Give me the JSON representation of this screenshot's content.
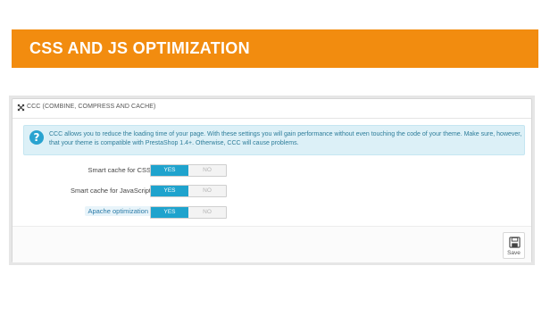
{
  "banner": {
    "title": "CSS AND JS OPTIMIZATION"
  },
  "panel": {
    "title": "CCC (COMBINE, COMPRESS AND CACHE)",
    "head_icon": "expand-arrows-icon",
    "info": {
      "icon": "question-icon",
      "icon_glyph": "?",
      "text": "CCC allows you to reduce the loading time of your page. With these settings you will gain performance without even touching the code of your theme. Make sure, however, that your theme is compatible with PrestaShop 1.4+. Otherwise, CCC will cause problems."
    },
    "settings": [
      {
        "label": "Smart cache for CSS",
        "yes": "YES",
        "no": "NO",
        "value": "YES"
      },
      {
        "label": "Smart cache for JavaScript",
        "yes": "YES",
        "no": "NO",
        "value": "YES"
      },
      {
        "label": "Apache optimization",
        "yes": "YES",
        "no": "NO",
        "value": "YES"
      }
    ],
    "save": {
      "label": "Save",
      "icon": "save-icon"
    }
  },
  "colors": {
    "banner": "#f28c0f",
    "switch_on": "#1fa3cd",
    "info_bg": "#dcf0f7"
  }
}
